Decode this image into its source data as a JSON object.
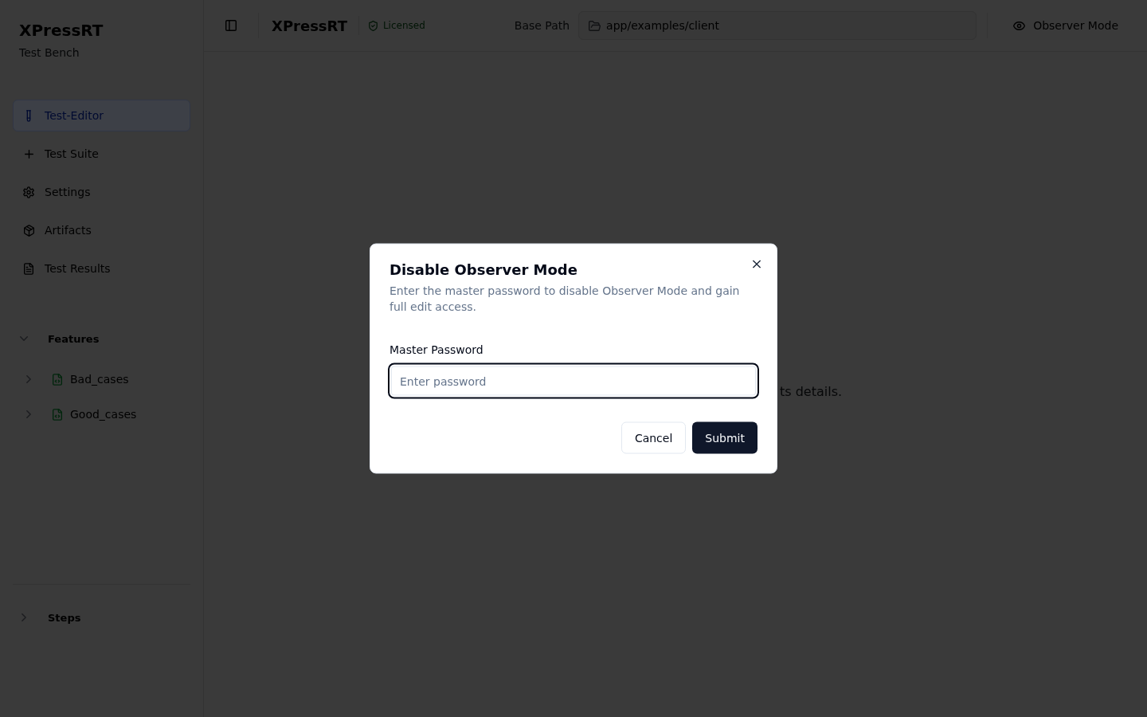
{
  "sidebar": {
    "title": "XPressRT",
    "subtitle": "Test Bench",
    "nav": [
      {
        "label": "Test-Editor",
        "selected": true
      },
      {
        "label": "Test Suite",
        "selected": false
      },
      {
        "label": "Settings",
        "selected": false
      },
      {
        "label": "Artifacts",
        "selected": false
      },
      {
        "label": "Test Results",
        "selected": false
      }
    ],
    "features": {
      "label": "Features",
      "expanded": true,
      "children": [
        {
          "label": "Bad_cases",
          "expanded": false
        },
        {
          "label": "Good_cases",
          "expanded": false
        }
      ]
    },
    "steps": {
      "label": "Steps",
      "expanded": false
    }
  },
  "header": {
    "title": "XPressRT",
    "license": "Licensed",
    "base_path_label": "Base Path",
    "base_path": "app/examples/client",
    "mode_button": "Observer Mode"
  },
  "main": {
    "hint": "ts details."
  },
  "dialog": {
    "title": "Disable Observer Mode",
    "description": "Enter the master password to disable Observer Mode and gain full edit access.",
    "field": {
      "label": "Master Password",
      "placeholder": "Enter password",
      "focused": true
    },
    "buttons": [
      {
        "label": "Cancel",
        "kind": "secondary"
      },
      {
        "label": "Submit",
        "kind": "primary"
      }
    ]
  }
}
